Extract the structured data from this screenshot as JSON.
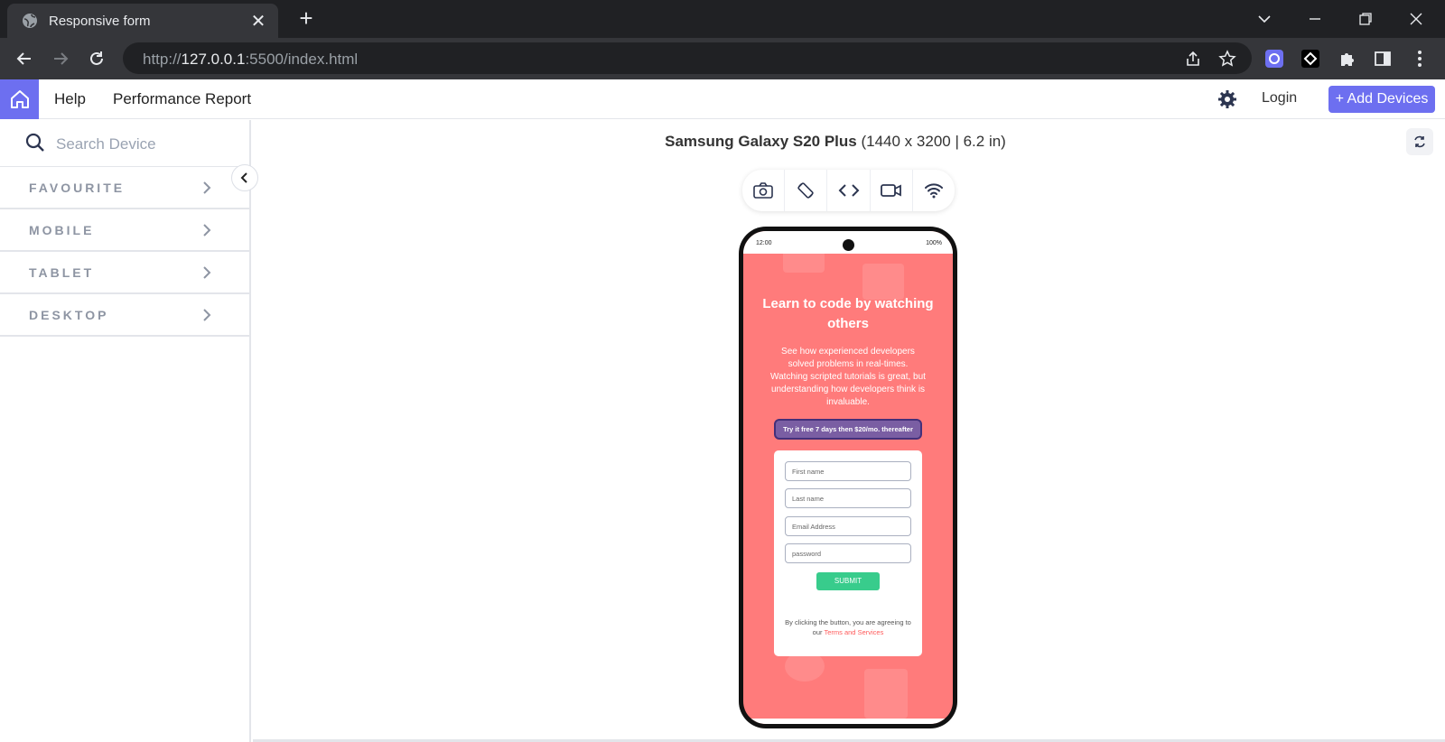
{
  "browser": {
    "tab_title": "Responsive form",
    "tab_close": "✕",
    "new_tab": "+",
    "url_scheme": "http://",
    "url_host": "127.0.0.1",
    "url_rest": ":5500/index.html"
  },
  "header": {
    "nav": [
      "Help",
      "Performance Report"
    ],
    "login": "Login",
    "add_devices": "+ Add Devices",
    "accent": "#6d6ff0"
  },
  "sidebar": {
    "search_placeholder": "Search Device",
    "categories": [
      "FAVOURITE",
      "MOBILE",
      "TABLET",
      "DESKTOP"
    ]
  },
  "device": {
    "name": "Samsung Galaxy S20 Plus",
    "specs": "(1440 x 3200 | 6.2 in)",
    "controls": [
      "camera-icon",
      "rotate-icon",
      "code-icon",
      "video-icon",
      "wifi-icon"
    ]
  },
  "phone": {
    "time": "12:00",
    "battery": "100%",
    "headline": "Learn to code by watching others",
    "description": "See how experienced developers solved problems in real-times. Watching scripted tutorials is great, but understanding how developers think is invaluable.",
    "try_free": "Try it free 7 days then $20/mo. thereafter",
    "fields": [
      "First name",
      "Last name",
      "Email Address",
      "password"
    ],
    "submit": "SUBMIT",
    "terms_prefix": "By clicking the button, you are agreeing to our",
    "terms_link": "Terms and Services",
    "bg_color": "#ff7b7b",
    "button_color": "#38cc8c"
  }
}
